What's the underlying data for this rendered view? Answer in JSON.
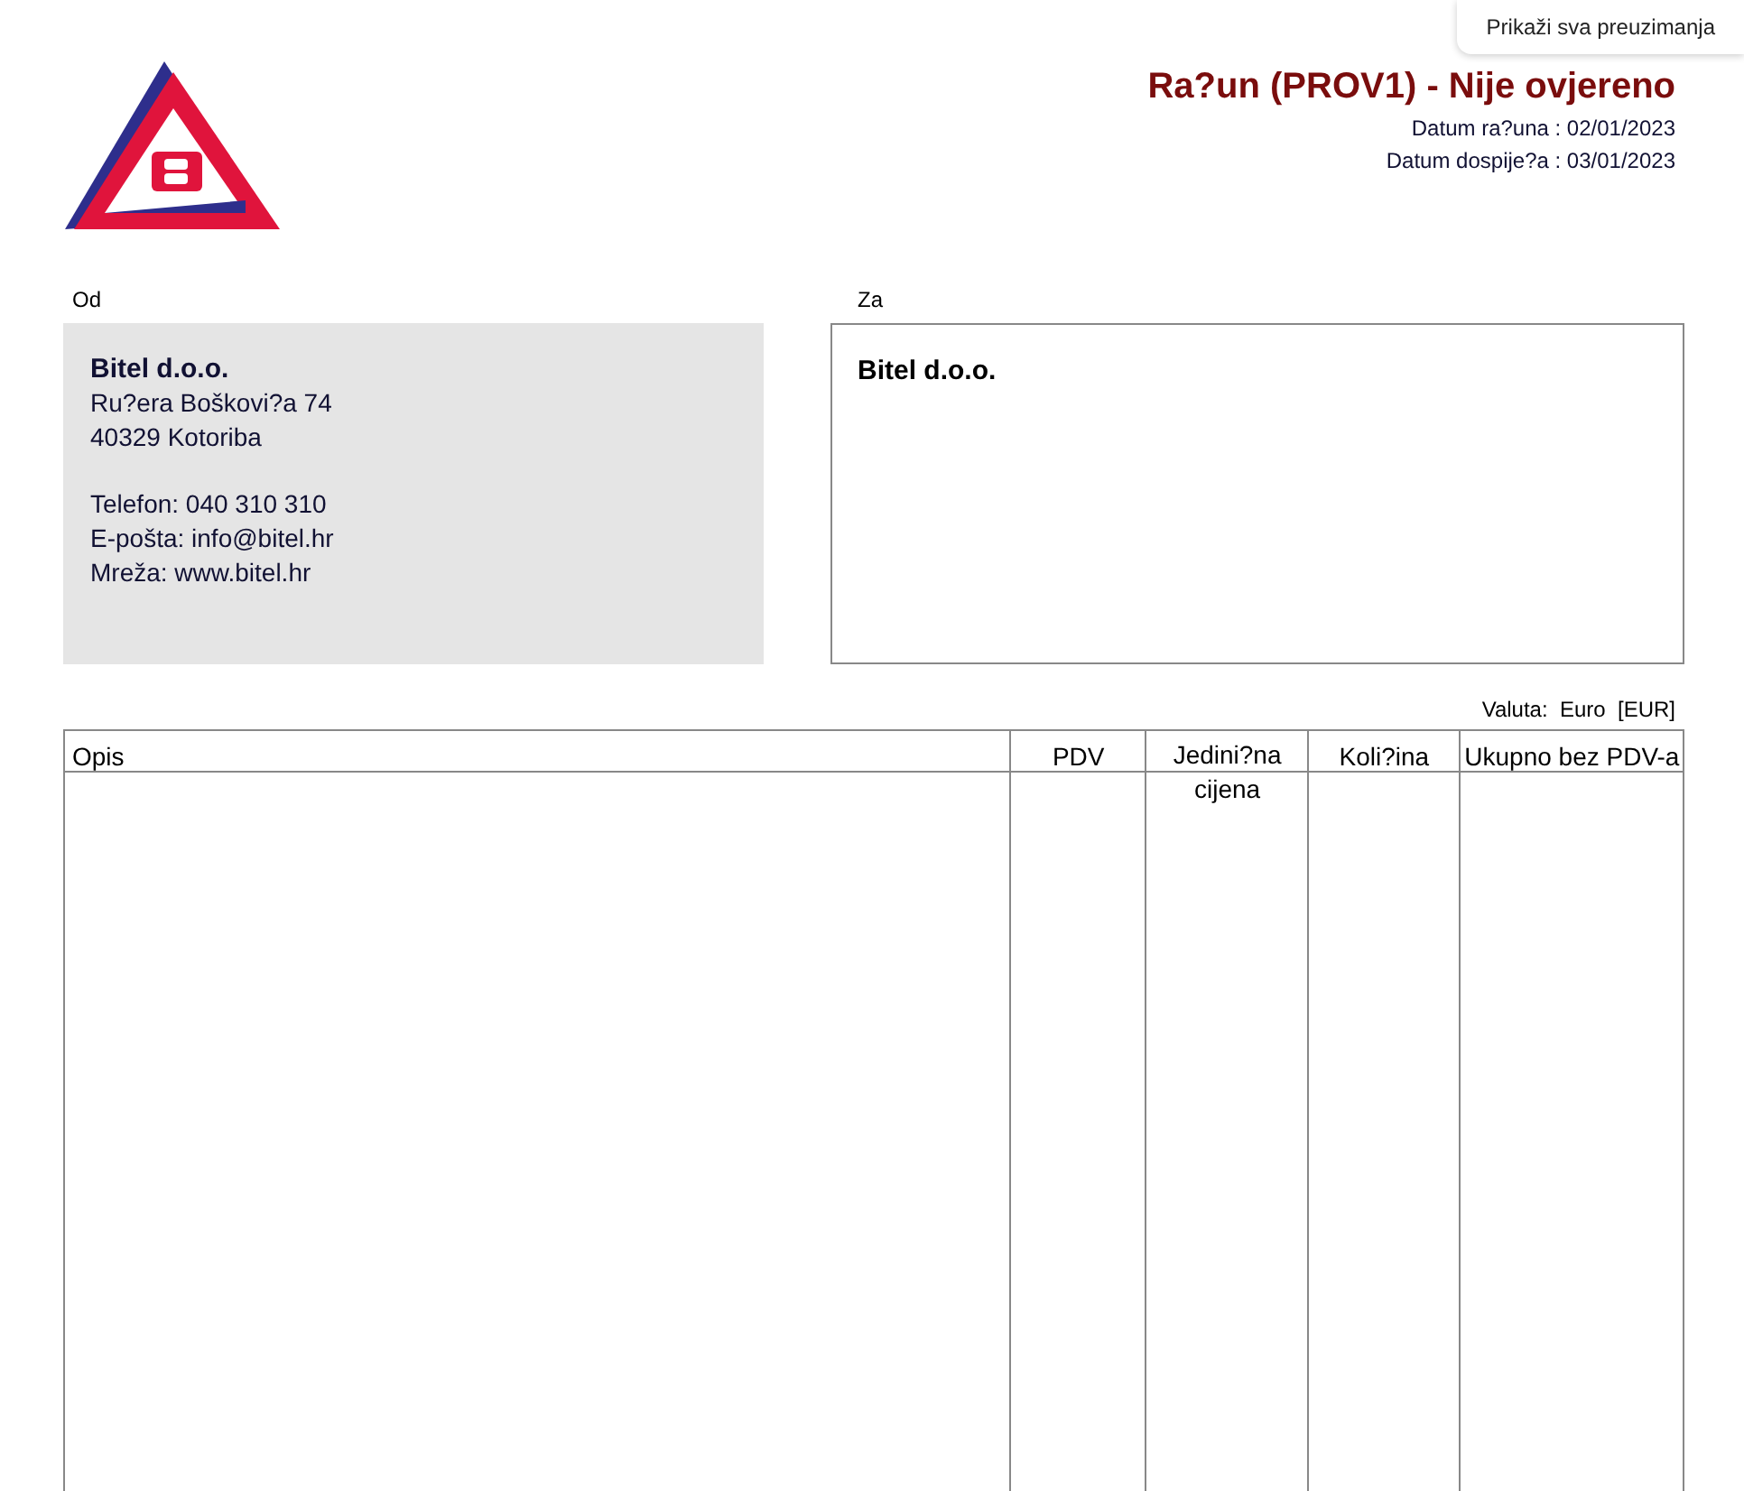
{
  "downloads_button": "Prikaži sva preuzimanja",
  "header": {
    "title": "Ra?un (PROV1) - Nije ovjereno",
    "dates": [
      "Datum ra?una : 02/01/2023",
      "Datum dospije?a : 03/01/2023"
    ]
  },
  "from": {
    "label": "Od",
    "name": "Bitel d.o.o.",
    "lines": [
      "Ru?era Boškovi?a 74",
      "40329 Kotoriba"
    ],
    "contact": [
      "Telefon: 040 310 310",
      "E-pošta: info@bitel.hr",
      "Mreža: www.bitel.hr"
    ]
  },
  "to": {
    "label": "Za",
    "name": "Bitel d.o.o."
  },
  "currency": "Valuta:  Euro  [EUR]",
  "table": {
    "columns": [
      {
        "label": "Opis"
      },
      {
        "label": "PDV"
      },
      {
        "label": "Jedini?na cijena"
      },
      {
        "label": "Koli?ina"
      },
      {
        "label": "Ukupno bez PDV-a"
      }
    ]
  }
}
